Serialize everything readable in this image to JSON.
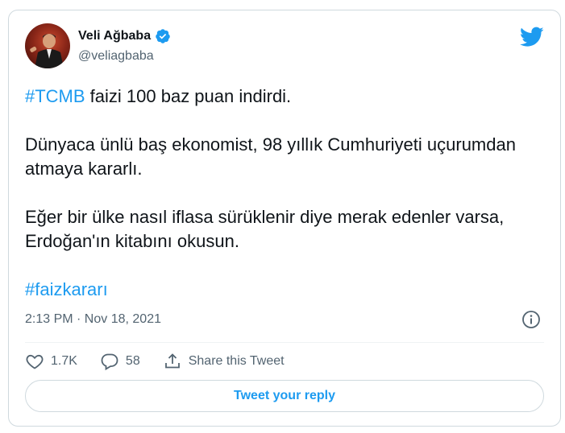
{
  "author": {
    "display_name": "Veli Ağbaba",
    "handle": "@veliagbaba",
    "verified": true
  },
  "tweet": {
    "hashtag_1": "#TCMB",
    "line_1_rest": " faizi 100 baz puan indirdi.",
    "paragraph_2": "Dünyaca ünlü baş ekonomist, 98 yıllık Cumhuriyeti uçurumdan atmaya kararlı.",
    "paragraph_3": "Eğer bir ülke nasıl iflasa sürüklenir diye merak edenler varsa, Erdoğan'ın kitabını okusun.",
    "hashtag_2": "#faizkararı"
  },
  "meta": {
    "timestamp": "2:13 PM · Nov 18, 2021"
  },
  "actions": {
    "likes": "1.7K",
    "replies": "58",
    "share_label": "Share this Tweet"
  },
  "reply_button_label": "Tweet your reply",
  "colors": {
    "accent": "#1d9bf0",
    "text": "#0f1419",
    "secondary": "#536471",
    "border": "#cfd9de"
  },
  "icons": {
    "brand": "twitter-bird-icon",
    "verified": "verified-badge-icon",
    "info": "info-icon",
    "like": "heart-icon",
    "reply": "speech-bubble-icon",
    "share": "share-upload-icon"
  }
}
